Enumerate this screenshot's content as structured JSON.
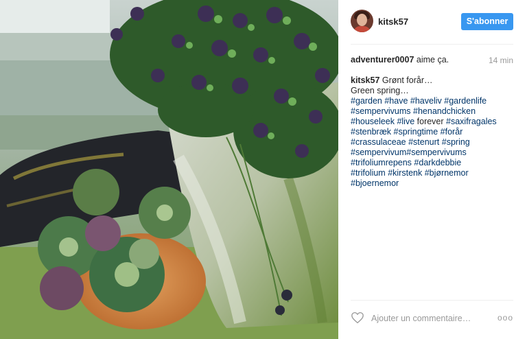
{
  "post": {
    "author": "kitsk57",
    "follow_label": "S'abonner",
    "likes": {
      "user": "adventurer0007",
      "text": " aime ça."
    },
    "timestamp": "14 min",
    "caption": {
      "user": "kitsk57",
      "text": "Grønt forår…",
      "line2": "Green spring…",
      "hashtag_lines": [
        [
          "#garden",
          "#have",
          "#haveliv",
          "#gardenlife"
        ],
        [
          "#sempervivums",
          "#henandchicken"
        ],
        [
          "#houseleek",
          "#live",
          "forever",
          "#saxifragales"
        ],
        [
          "#stenbræk",
          "#springtime",
          "#forår"
        ],
        [
          "#crassulaceae",
          "#stenurt",
          "#spring"
        ],
        [
          "#sempervivum#sempervivums"
        ],
        [
          "#trifoliumrepens",
          "#darkdebbie"
        ],
        [
          "#trifolium",
          "#kirstenk",
          "#bjørnemor"
        ],
        [
          "#bjoernemor"
        ]
      ]
    },
    "comment_placeholder": "Ajouter un commentaire…",
    "more_label": "ooo"
  },
  "icons": {
    "like": "heart-outline-icon",
    "more": "ellipsis-icon"
  },
  "colors": {
    "accent": "#3897f0",
    "hashtag": "#003569",
    "muted": "#999999"
  }
}
